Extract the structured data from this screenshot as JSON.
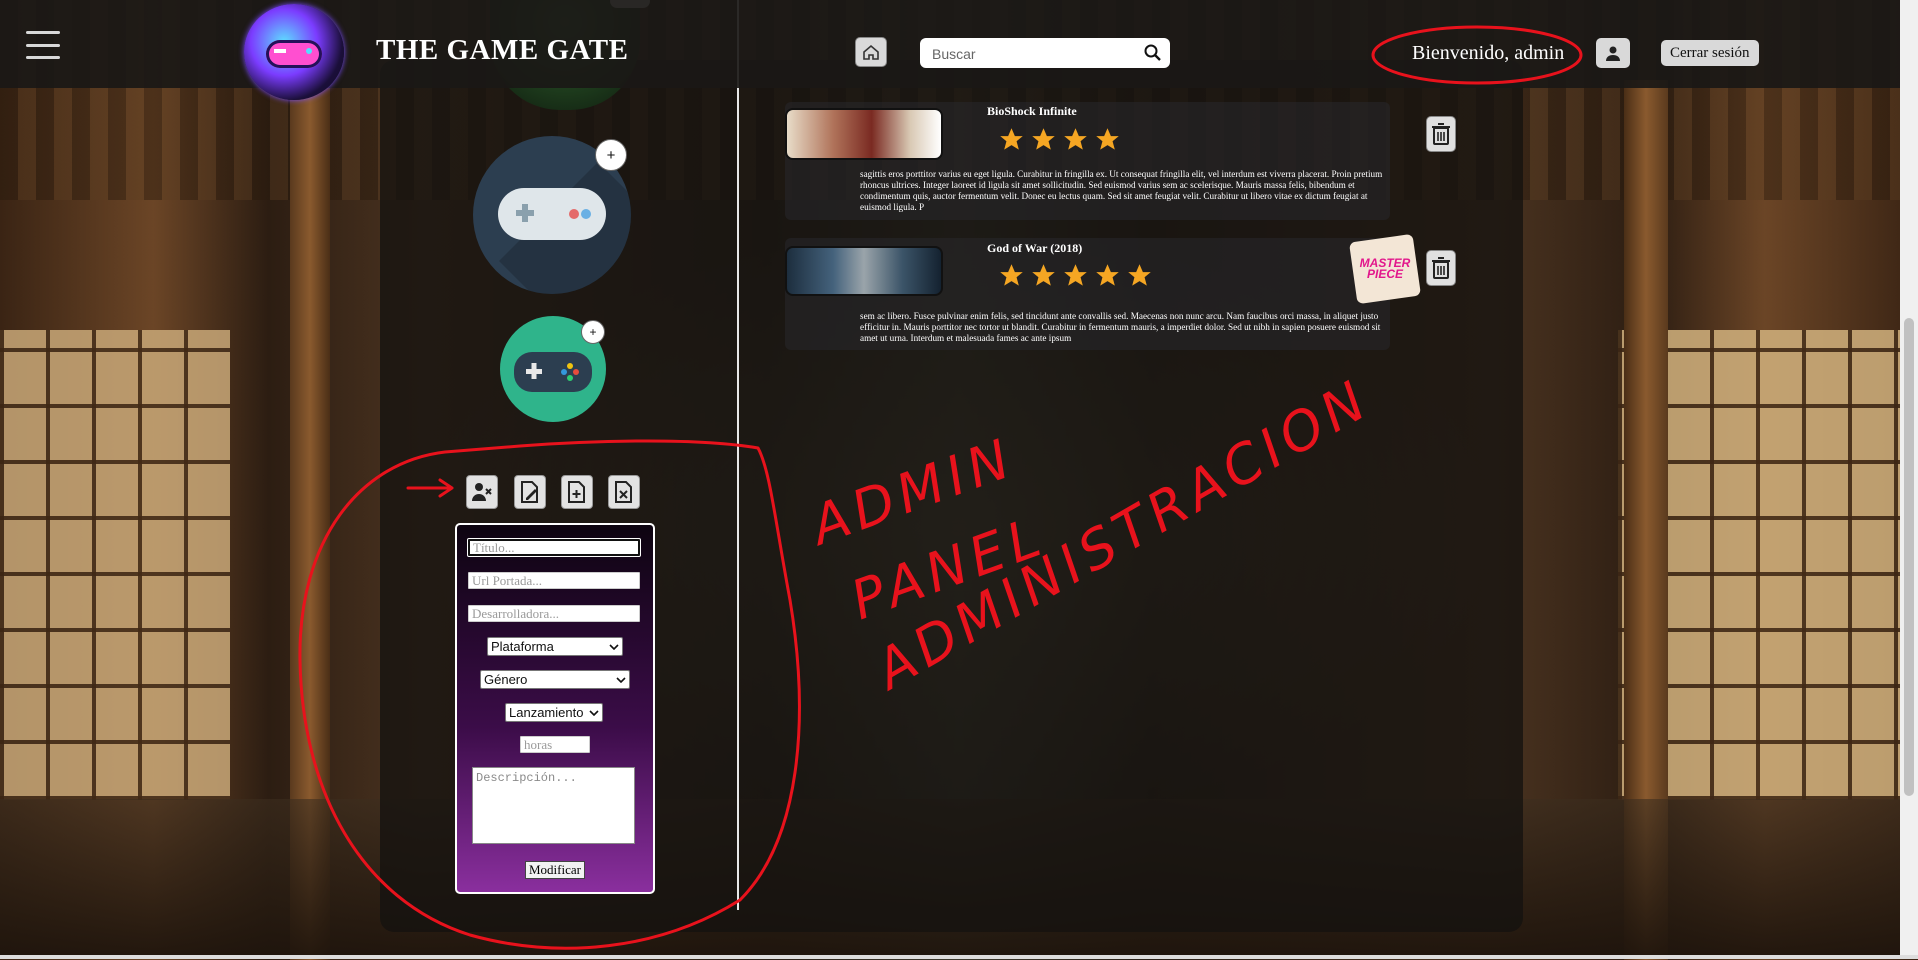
{
  "header": {
    "brand": "THE GAME GATE",
    "search_placeholder": "Buscar",
    "welcome": "Bienvenido, admin",
    "logout_label": "Cerrar sesión"
  },
  "admin_form": {
    "titulo_placeholder": "Título...",
    "portada_placeholder": "Url Portada...",
    "desarrolladora_placeholder": "Desarrolladora...",
    "plataforma_value": "Plataforma",
    "genero_value": "Género",
    "lanzamiento_value": "Lanzamiento",
    "horas_placeholder": "horas",
    "descripcion_placeholder": "Descripción...",
    "submit_label": "Modificar"
  },
  "avatars": {
    "plus_label": "+"
  },
  "games": [
    {
      "title": "BioShock Infinite",
      "rating": 4,
      "description": "sagittis eros porttitor varius eu eget ligula. Curabitur in fringilla ex. Ut consequat fringilla elit, vel interdum est viverra placerat. Proin pretium rhoncus ultrices. Integer laoreet id ligula sit amet sollicitudin. Sed euismod varius sem ac scelerisque. Mauris massa felis, bibendum et condimentum quis, auctor fermentum velit. Donec eu lectus quam. Sed sit amet feugiat velit. Curabitur ut libero vitae ex dictum feugiat at euismod ligula. P"
    },
    {
      "title": "God of War (2018)",
      "rating": 5,
      "description": "sem ac libero. Fusce pulvinar enim felis, sed tincidunt ante convallis sed. Maecenas non nunc arcu. Nam faucibus orci massa, in aliquet justo efficitur in. Mauris porttitor nec tortor ut blandit. Curabitur in fermentum mauris, a imperdiet dolor. Sed ut nibh in sapien posuere euismod sit amet ut urna. Interdum et malesuada fames ac ante ipsum",
      "badge": "MASTER PIECE"
    }
  ],
  "annotations": {
    "line1": "ADMIN",
    "line2": "PANEL",
    "line3": "ADMINISTRACION"
  },
  "colors": {
    "accent_red": "#e8121c",
    "form_gradient_top": "#0d0410",
    "form_gradient_bottom": "#8a2f9e",
    "star": "#f5a623"
  }
}
